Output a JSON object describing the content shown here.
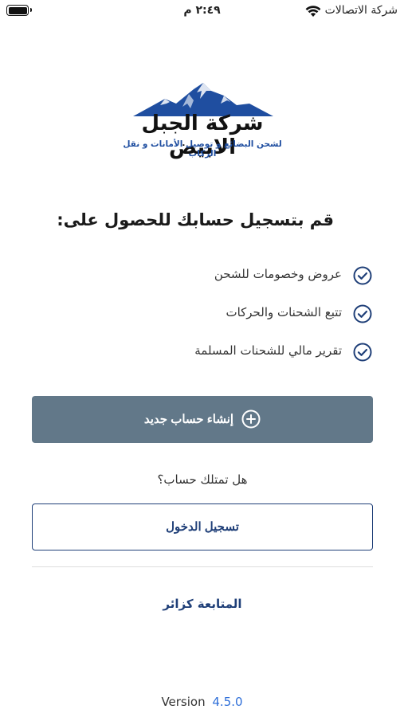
{
  "status_bar": {
    "carrier": "شركة الاتصالات",
    "time": "٢:٤٩ م",
    "icons": [
      "wifi-icon",
      "battery-icon"
    ]
  },
  "logo": {
    "name": "شركة الجبل الابيض",
    "tagline": "لشحن البضائع و توصيل الأمانات و نقل الركاب",
    "colors": {
      "mountain": "#1f4ea0",
      "text": "#111111"
    }
  },
  "headline": "قم بتسجيل حسابك للحصول على:",
  "benefits": [
    {
      "label": "عروض وخصومات للشحن",
      "icon": "check-circle-icon"
    },
    {
      "label": "تتبع الشحنات والحركات",
      "icon": "check-circle-icon"
    },
    {
      "label": "تقرير مالي للشحنات المسلمة",
      "icon": "check-circle-icon"
    }
  ],
  "create_account_button": {
    "label": "إنشاء حساب جديد",
    "icon": "plus-circle-icon",
    "color": "#627889"
  },
  "have_account_text": "هل تمتلك حساب؟",
  "login_button": {
    "label": "تسجيل الدخول",
    "color": "#1f3f78"
  },
  "guest_link": "المتابعة كزائر",
  "version": {
    "label": "Version",
    "number": "4.5.0"
  },
  "colors": {
    "accent": "#1f3f78",
    "check": "#1f3f78",
    "version_number": "#2f6fd8"
  }
}
